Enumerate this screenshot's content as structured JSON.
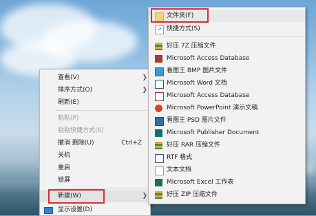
{
  "context_menu": {
    "items": [
      {
        "label": "查看(V)",
        "has_submenu": true,
        "disabled": false
      },
      {
        "label": "排序方式(O)",
        "has_submenu": true,
        "disabled": false
      },
      {
        "label": "刷新(E)",
        "has_submenu": false,
        "disabled": false
      },
      {
        "label": "粘贴(P)",
        "has_submenu": false,
        "disabled": true
      },
      {
        "label": "粘贴快捷方式(S)",
        "has_submenu": false,
        "disabled": true
      },
      {
        "label": "撤消 删除(U)",
        "shortcut": "Ctrl+Z",
        "has_submenu": false,
        "disabled": false
      },
      {
        "label": "关机",
        "has_submenu": false,
        "disabled": false
      },
      {
        "label": "重启",
        "has_submenu": false,
        "disabled": false
      },
      {
        "label": "锁屏",
        "has_submenu": false,
        "disabled": false
      },
      {
        "label": "新建(W)",
        "has_submenu": true,
        "disabled": false,
        "highlighted": true
      }
    ],
    "partial_item": "显示设置(D)"
  },
  "new_submenu": {
    "items": [
      {
        "label": "文件夹(F)",
        "icon": "folder-icon",
        "highlighted": true
      },
      {
        "label": "快捷方式(S)",
        "icon": "shortcut-icon"
      },
      {
        "label": "好压 7Z 压缩文件",
        "icon": "archive-icon"
      },
      {
        "label": "Microsoft Access Database",
        "icon": "access-icon"
      },
      {
        "label": "看图王 BMP 图片文件",
        "icon": "image-icon"
      },
      {
        "label": "Microsoft Word 文档",
        "icon": "word-icon"
      },
      {
        "label": "Microsoft Access Database",
        "icon": "access-icon"
      },
      {
        "label": "Microsoft PowerPoint 演示文稿",
        "icon": "powerpoint-icon"
      },
      {
        "label": "看图王 PSD 图片文件",
        "icon": "psd-icon"
      },
      {
        "label": "Microsoft Publisher Document",
        "icon": "publisher-icon"
      },
      {
        "label": "好压 RAR 压缩文件",
        "icon": "archive-icon"
      },
      {
        "label": "RTF 格式",
        "icon": "rtf-icon"
      },
      {
        "label": "文本文档",
        "icon": "text-icon"
      },
      {
        "label": "Microsoft Excel 工作表",
        "icon": "excel-icon"
      },
      {
        "label": "好压 ZIP 压缩文件",
        "icon": "archive-icon"
      }
    ]
  },
  "colors": {
    "highlight_border": "#d0313b",
    "menu_bg": "#f2f2f2"
  }
}
